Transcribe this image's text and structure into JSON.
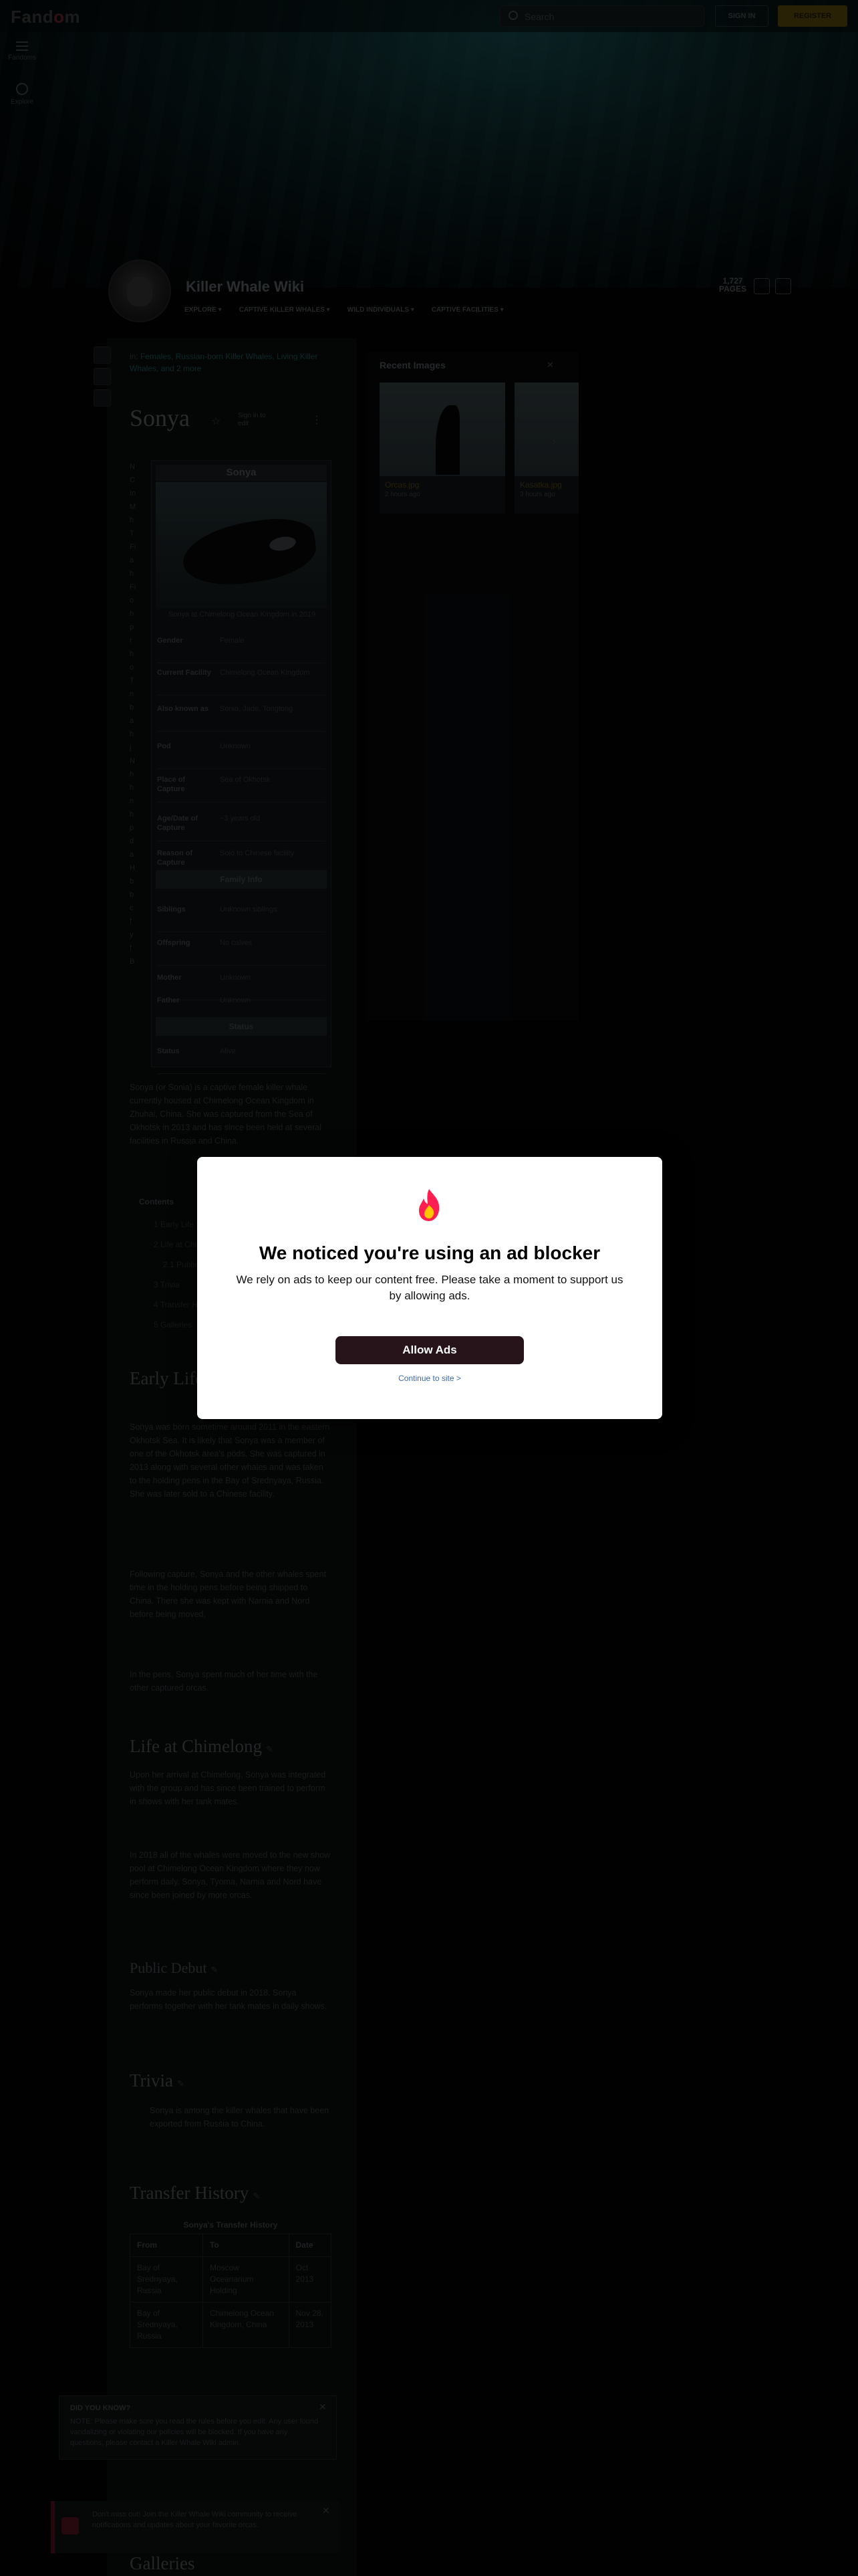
{
  "topbar": {
    "logo_left": "Fand",
    "logo_o": "o",
    "logo_right": "m",
    "search_placeholder": "Search",
    "sign_in": "SIGN IN",
    "register": "REGISTER"
  },
  "rail": {
    "menu_label": "Fandoms",
    "explore_label": "Explore"
  },
  "wiki": {
    "title": "Killer Whale Wiki",
    "nav": [
      "EXPLORE",
      "CAPTIVE KILLER WHALES",
      "WILD INDIVIDUALS",
      "CAPTIVE FACILITIES"
    ],
    "pages_count": "1,727",
    "pages_label": "PAGES"
  },
  "article": {
    "breadcrumb_prefix": "in:",
    "breadcrumb_links": "Females, Russian-born Killer Whales, Living Killer Whales,",
    "breadcrumb_more": "and 2 more",
    "title": "Sonya",
    "sign_in_to_edit": "Sign in to edit",
    "letters": [
      "N",
      "C",
      "In",
      "M",
      "h",
      "T",
      "Fi",
      "a",
      "h",
      "Fi",
      "o",
      "h",
      "p",
      "r",
      "h",
      "o",
      "T",
      "n",
      "b",
      "a",
      "h",
      "j",
      "N",
      "h",
      "h",
      "n",
      "h",
      "p",
      "d",
      "a",
      "H",
      "b",
      "b",
      "c",
      "f",
      "y",
      "f",
      "B"
    ]
  },
  "infobox": {
    "title": "Sonya",
    "caption": "Sonya at Chimelong Ocean Kingdom in 2019",
    "rows": [
      {
        "k": "Gender",
        "v": "Female"
      },
      {
        "k": "Current Facility",
        "v": "Chimelong Ocean Kingdom"
      },
      {
        "k": "Also known as",
        "v": "Sonia, Jade, Tongtong"
      },
      {
        "k": "Pod",
        "v": "Unknown"
      },
      {
        "k": "Place of Capture",
        "v": "Sea of Okhotsk"
      },
      {
        "k": "Age/Date of Capture",
        "v": "~3 years old"
      },
      {
        "k": "Reason of Capture",
        "v": "Sold to Chinese facility"
      }
    ],
    "family_header": "Family Info",
    "family_rows": [
      {
        "k": "Siblings",
        "v": "Unknown siblings"
      },
      {
        "k": "Offspring",
        "v": "No calves"
      },
      {
        "k": "Mother",
        "v": "Unknown"
      },
      {
        "k": "Father",
        "v": "Unknown"
      }
    ],
    "status_header": "Status",
    "status_rows": [
      {
        "k": "Status",
        "v": "Alive"
      }
    ]
  },
  "intro": {
    "text": "Sonya (or Sonia) is a captive female killer whale currently housed at Chimelong Ocean Kingdom in Zhuhai, China. She was captured from the Sea of Okhotsk in 2013 and has since been held at several facilities in Russia and China."
  },
  "toc": {
    "title": "Contents",
    "items": [
      "1 Early Life",
      "2 Life at Chimelong",
      "2.1 Public Debut",
      "3 Trivia",
      "4 Transfer History",
      "5 Galleries"
    ]
  },
  "sections": {
    "early_life": "Early Life",
    "early_p1": "Sonya was born sometime around 2011 in the eastern Okhotsk Sea. It is likely that Sonya was a member of one of the Okhotsk area's pods. She was captured in 2013 along with several other whales and was taken to the holding pens in the Bay of Srednyaya, Russia. She was later sold to a Chinese facility.",
    "early_p2": "Following capture, Sonya and the other whales spent time in the holding pens before being shipped to China. There she was kept with Narnia and Nord before being moved.",
    "early_p3": "In the pens, Sonya spent much of her time with the other captured orcas.",
    "life_at": "Life at Chimelong",
    "life_p1": "Upon her arrival at Chimelong, Sonya was integrated with the group and has since been trained to perform in shows with her tank mates.",
    "life_p2": "In 2018 all of the whales were moved to the new show pool at Chimelong Ocean Kingdom where they now perform daily. Sonya, Tyoma, Narnia and Nord have since been joined by more orcas.",
    "public_debut": "Public Debut",
    "debut_p": "Sonya made her public debut in 2018. Sonya performs together with her tank mates in daily shows.",
    "trivia": "Trivia",
    "trivia_p": "Sonya is among the killer whales that have been exported from Russia to China.",
    "transfer_history": "Transfer History"
  },
  "transfer_table": {
    "title": "Sonya's Transfer History",
    "headers": [
      "From",
      "To",
      "Date"
    ],
    "rows": [
      [
        "Bay of Srednyaya, Russia",
        "Moscow Oceanarium Holding",
        "Oct 2013"
      ],
      [
        "Bay of Srednyaya, Russia",
        "Chimelong Ocean Kingdom, China",
        "Nov 28, 2013"
      ]
    ]
  },
  "right_rail": {
    "title": "Recent Images",
    "close": "✕",
    "images": [
      {
        "caption": "Orcas.jpg",
        "sub": "2 hours ago"
      },
      {
        "caption": "Kasatka.jpg",
        "sub": "3 hours ago"
      }
    ]
  },
  "notices": {
    "n1_title": "DID YOU KNOW?",
    "n1_body": "NOTE: Please make sure you read the rules before you edit. Any user found vandalizing or violating our policies will be blocked. If you have any questions, please contact a Killer Whale Wiki admin.",
    "n2_body": "Don't miss out! Join the Killer Whale Wiki community to receive notifications and updates about your favorite orcas."
  },
  "galleries_heading": "Galleries",
  "modal": {
    "title": "We noticed you're using an ad blocker",
    "body": "We rely on ads to keep our content free. Please take a moment to support us by allowing ads.",
    "allow": "Allow Ads",
    "continue": "Continue to site >"
  },
  "colors": {
    "accent": "#ff1e50",
    "flame_inner": "#ffc500",
    "button_dark": "#26141a",
    "link_blue": "#3f6aa3"
  }
}
